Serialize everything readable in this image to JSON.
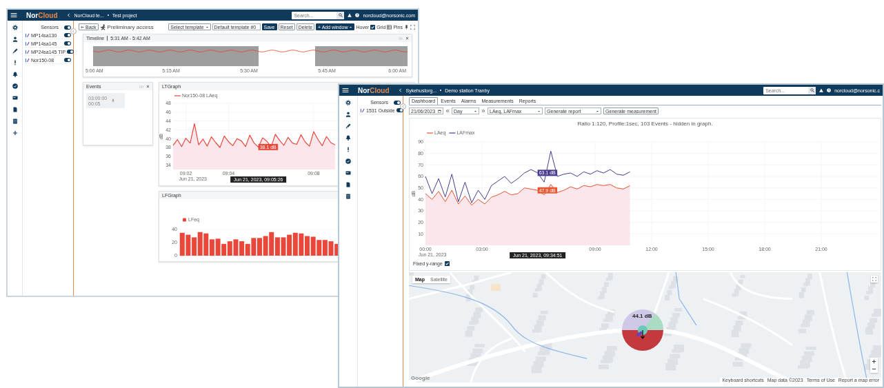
{
  "windows": [
    {
      "kind": "project",
      "topbar": {
        "logo": {
          "first": "Nor",
          "second": "Cloud"
        },
        "breadcrumb": [
          "NorCloud te...",
          "Test project"
        ],
        "search": {
          "placeholder": "Search..."
        },
        "user": "norcloud@norsonic.com"
      },
      "rail": [
        {
          "kind": "gear"
        },
        {
          "kind": "user"
        },
        {
          "kind": "brush"
        },
        {
          "kind": "alert"
        },
        {
          "kind": "bell"
        },
        {
          "kind": "check"
        },
        {
          "kind": "card"
        },
        {
          "kind": "file"
        },
        {
          "kind": "database"
        },
        {
          "kind": "plus"
        }
      ],
      "sensors": {
        "header": "Sensors",
        "on": true,
        "items": [
          {
            "name": "MP14sa130",
            "on": true
          },
          {
            "name": "MP14sa145",
            "on": true
          },
          {
            "name": "MP24sa145 TIP",
            "on": true
          },
          {
            "name": "Nor150-08",
            "on": true
          }
        ]
      },
      "toolbar": {
        "back": "Back",
        "title": "Preliminary access",
        "template_select": "Select template",
        "template_name": "Default template #0",
        "actions": [
          {
            "label": "Save",
            "kind": "primary"
          },
          {
            "label": "Reset",
            "kind": "plain"
          },
          {
            "label": "Delete",
            "kind": "plain"
          },
          {
            "label": "+ Add window",
            "kind": "menu"
          }
        ],
        "options": [
          {
            "kind": "checkbox",
            "label": "Hover",
            "checked": true
          },
          {
            "kind": "grid",
            "label": "Grid"
          },
          {
            "kind": "pin",
            "label": "Pins"
          }
        ]
      },
      "timeline": {
        "title": "Timeline",
        "range": "5:31 AM - 5:42 AM",
        "ticks": [
          "5:00 AM",
          "5:15 AM",
          "5:30 AM",
          "5:45 AM",
          "6:00 AM"
        ]
      },
      "events": {
        "title": "Events",
        "items": [
          {
            "time": "03:00:00",
            "duration": "00:05"
          }
        ]
      },
      "lt_graph": {
        "title": "LTGraph",
        "date_label": "Jun 21, 2023",
        "chart_data": {
          "type": "line",
          "grid": true,
          "legend": "top-left",
          "ylabel": "dB",
          "xlim": [
            9.0233,
            9.2067
          ],
          "ylim": [
            33,
            48
          ],
          "yticks": [
            34,
            36,
            38,
            40,
            42,
            44,
            46,
            48
          ],
          "xticks": [
            {
              "value": 9.0333,
              "label": "09:02"
            },
            {
              "value": 9.0667,
              "label": "09:04"
            },
            {
              "value": 9.1333,
              "label": "09:08"
            }
          ],
          "x": [
            9.0233,
            9.0267,
            9.03,
            9.0333,
            9.0367,
            9.04,
            9.0433,
            9.0467,
            9.05,
            9.0533,
            9.0567,
            9.06,
            9.0633,
            9.0667,
            9.07,
            9.0733,
            9.0767,
            9.08,
            9.0833,
            9.0867,
            9.09,
            9.0933,
            9.0967,
            9.1,
            9.1033,
            9.1067,
            9.11,
            9.1133,
            9.1167,
            9.12,
            9.1233,
            9.1267,
            9.13,
            9.1333,
            9.1367,
            9.14,
            9.1433,
            9.1467,
            9.15
          ],
          "series": [
            {
              "name": "Nor150-08 LAeq",
              "color": "#e8473a",
              "values": [
                38.5,
                39.8,
                38.2,
                40.1,
                39.0,
                43.4,
                38.6,
                39.9,
                38.3,
                40.4,
                39.1,
                38.0,
                40.6,
                39.3,
                38.4,
                40.0,
                39.5,
                38.2,
                40.8,
                39.0,
                38.1,
                40.2,
                39.4,
                38.1,
                41.0,
                39.6,
                38.5,
                40.3,
                39.0,
                38.7,
                40.9,
                39.2,
                38.3,
                41.6,
                39.8,
                38.4,
                40.5,
                39.1,
                38.6
              ]
            }
          ],
          "annotations": [
            {
              "x": 9.09,
              "y": 38.1,
              "text": "38.1 dB"
            },
            "Jun 21, 2023, 09:05:26"
          ]
        }
      },
      "lf_graph": {
        "title": "LFGraph",
        "chart_data": {
          "type": "bar",
          "grid": true,
          "legend": "top-left",
          "ylim": [
            0,
            40
          ],
          "yticks": [
            0,
            20,
            40
          ],
          "series": [
            {
              "name": "LFeq",
              "color": "#e8473a",
              "values": [
                35,
                32,
                28,
                36,
                34,
                25,
                26,
                18,
                22,
                25,
                22,
                18,
                27,
                27,
                30,
                36,
                28,
                28,
                32,
                35,
                34,
                30,
                29,
                24,
                24,
                22,
                18
              ]
            }
          ]
        }
      }
    },
    {
      "kind": "station",
      "topbar": {
        "logo": {
          "first": "Nor",
          "second": "Cloud"
        },
        "breadcrumb": [
          "Sykehustorg...",
          "Demo station Tranby"
        ],
        "search": {
          "placeholder": "Search..."
        },
        "user": "norcloud@norsonic.c"
      },
      "rail": [
        {
          "kind": "gear"
        },
        {
          "kind": "user"
        },
        {
          "kind": "brush"
        },
        {
          "kind": "bell"
        },
        {
          "kind": "alert"
        },
        {
          "kind": "check"
        },
        {
          "kind": "card"
        },
        {
          "kind": "file"
        },
        {
          "kind": "database"
        }
      ],
      "sensors": {
        "header": "Sensors",
        "on": true,
        "items": [
          {
            "name": "1531 Outside",
            "on": true
          }
        ]
      },
      "tabs": [
        {
          "label": "Dashboard",
          "selected": true
        },
        {
          "label": "Events",
          "selected": false
        },
        {
          "label": "Alarms",
          "selected": false
        },
        {
          "label": "Measurements",
          "selected": false
        },
        {
          "label": "Reports",
          "selected": false
        }
      ],
      "controls": {
        "date": "21/06/2023",
        "period": "Day",
        "metrics": "LAeq, LAFmax",
        "report": "Generate report",
        "action": "Generate measurement"
      },
      "chart": {
        "title": "Ratio 1:120, Profile:1sec, 103 Events - hidden in graph.",
        "date_label": "Jun 21, 2023",
        "chart_data": {
          "type": "line",
          "grid": true,
          "legend": "top-left",
          "ylabel": "dB",
          "xlim": [
            0,
            24
          ],
          "ylim": [
            0,
            90
          ],
          "yticks": [
            10,
            20,
            30,
            40,
            50,
            60,
            70,
            80,
            90
          ],
          "xticks": [
            {
              "value": 0,
              "label": "00:00"
            },
            {
              "value": 3,
              "label": "03:00"
            },
            {
              "value": 9,
              "label": "09:00"
            },
            {
              "value": 12,
              "label": "12:00"
            },
            {
              "value": 15,
              "label": "15:00"
            },
            {
              "value": 18,
              "label": "18:00"
            },
            {
              "value": 21,
              "label": "21:00"
            }
          ],
          "x": [
            0,
            0.35,
            0.7,
            1.05,
            1.4,
            1.75,
            2.1,
            2.45,
            2.8,
            3.15,
            3.5,
            3.85,
            4.2,
            4.55,
            4.9,
            5.25,
            5.6,
            5.95,
            6.3,
            6.65,
            7,
            7.35,
            7.7,
            8.05,
            8.4,
            8.75,
            9.1,
            9.45,
            9.8,
            10.15,
            10.5,
            10.85
          ],
          "series": [
            {
              "name": "LAeq",
              "color": "#e8552f",
              "values": [
                45,
                40,
                47,
                38,
                48,
                36,
                43,
                35,
                40,
                36,
                42,
                44,
                47,
                44,
                45,
                50,
                49,
                47.9,
                44,
                53,
                46,
                48,
                51,
                49,
                52,
                51,
                53,
                52,
                53,
                50,
                49,
                52
              ]
            },
            {
              "name": "LAFmax",
              "color": "#4b3a8f",
              "values": [
                60,
                45,
                58,
                42,
                62,
                38,
                55,
                37,
                48,
                40,
                52,
                56,
                60,
                54,
                58,
                63,
                66,
                63.1,
                55,
                82,
                60,
                62,
                63,
                60,
                64,
                62,
                65,
                63,
                66,
                62,
                61,
                64
              ]
            }
          ],
          "annotations": [
            {
              "x": 5.95,
              "y": 63.1,
              "text": "63.1 dB"
            },
            {
              "x": 5.95,
              "y": 47.9,
              "text": "47.9 dB"
            },
            "Jun 21, 2023, 09:34:51"
          ]
        },
        "fixed_y_range": {
          "label": "Fixed y-range",
          "checked": true
        }
      },
      "map": {
        "types": [
          {
            "label": "Map",
            "selected": true
          },
          {
            "label": "Satellite",
            "selected": false
          }
        ],
        "reading": "44.1 dB",
        "logo": "Google",
        "attribution": [
          "Keyboard shortcuts",
          "Map data ©2023",
          "Terms of Use",
          "Report a map error"
        ]
      }
    }
  ]
}
